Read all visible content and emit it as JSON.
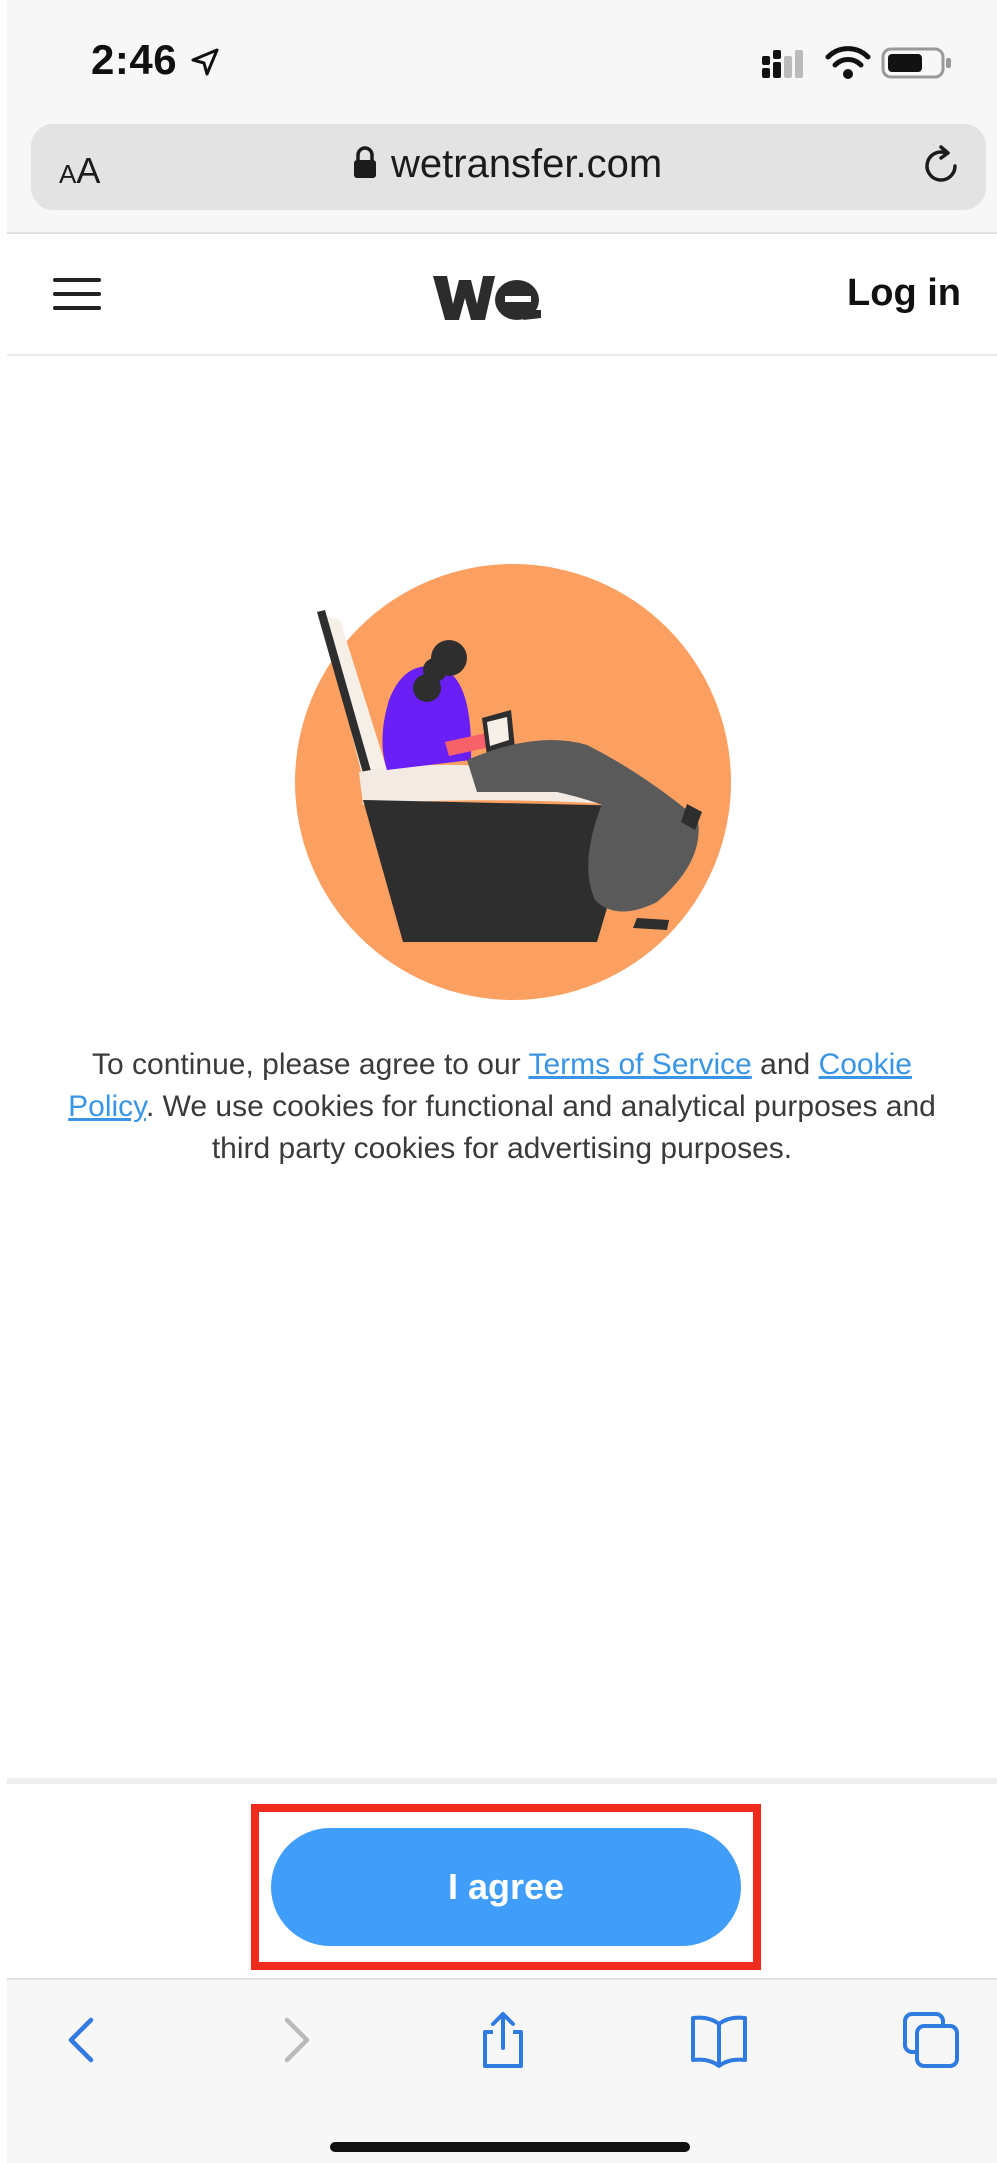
{
  "status_bar": {
    "time": "2:46",
    "icons": [
      "location-arrow-icon",
      "cellular-signal-icon",
      "wifi-icon",
      "battery-icon"
    ]
  },
  "browser": {
    "text_size_label_small": "A",
    "text_size_label_large": "A",
    "url": "wetransfer.com",
    "icons": [
      "lock-icon",
      "reload-icon"
    ]
  },
  "site_header": {
    "login_label": "Log in",
    "icons": [
      "hamburger-menu-icon",
      "wetransfer-logo"
    ]
  },
  "consent": {
    "prefix": "To continue, please agree to our ",
    "terms_link": "Terms of Service",
    "middle": " and ",
    "cookie_link": "Cookie Policy",
    "suffix": ". We use cookies for functional and analytical purposes and third party cookies for advertising purposes."
  },
  "action": {
    "agree_label": "I agree"
  },
  "toolbar": {
    "icons": [
      "back-icon",
      "forward-icon",
      "share-icon",
      "bookmarks-icon",
      "tabs-icon"
    ]
  },
  "colors": {
    "accent_blue": "#409dfa",
    "link_blue": "#3b95e6",
    "highlight_red": "#f02a1c",
    "illustration_orange": "#fba061",
    "illustration_purple": "#6b1ff7"
  }
}
